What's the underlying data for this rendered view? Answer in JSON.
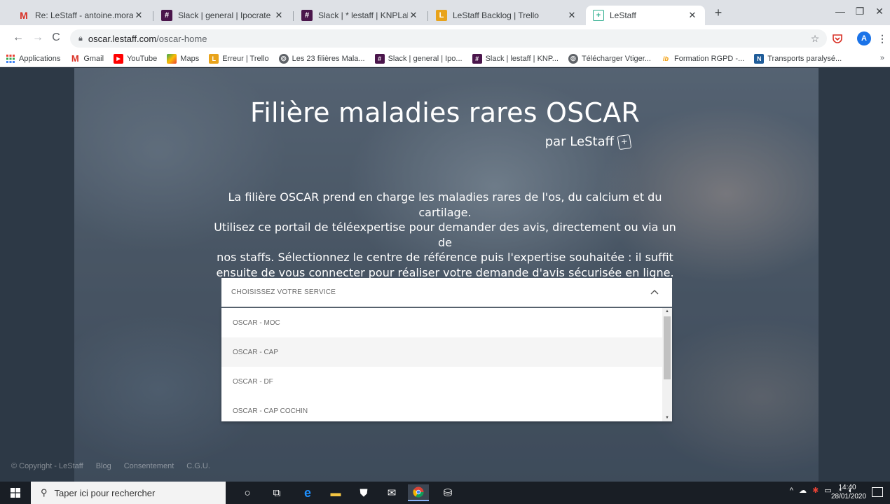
{
  "browser": {
    "tabs": [
      {
        "title": "Re: LeStaff - antoine.morant@ipo",
        "icon": "gmail-icon",
        "color": "#d93025",
        "glyph": "M"
      },
      {
        "title": "Slack | general | Ipocrate",
        "icon": "slack-icon",
        "color": "#4a154b",
        "glyph": "#"
      },
      {
        "title": "Slack | * lestaff | KNPLabs",
        "icon": "slack-icon",
        "color": "#4a154b",
        "glyph": "#"
      },
      {
        "title": "LeStaff Backlog | Trello",
        "icon": "trello-icon",
        "color": "#e8a31b",
        "glyph": "L"
      },
      {
        "title": "LeStaff",
        "icon": "lestaff-icon",
        "color": "#2fae8f",
        "glyph": "+"
      }
    ],
    "active_tab": 4,
    "new_tab": "+",
    "url_host": "oscar.lestaff.com",
    "url_path": "/oscar-home",
    "profile_initial": "A",
    "bookmarks": [
      {
        "label": "Applications",
        "icon": "apps-grid-icon",
        "color": "#e94235",
        "glyph": "⋮"
      },
      {
        "label": "Gmail",
        "icon": "gmail-icon",
        "color": "#d93025",
        "glyph": "M"
      },
      {
        "label": "YouTube",
        "icon": "youtube-icon",
        "color": "#ff0000",
        "glyph": "▶"
      },
      {
        "label": "Maps",
        "icon": "maps-icon",
        "color": "#34a853",
        "glyph": "◆"
      },
      {
        "label": "Erreur | Trello",
        "icon": "trello-icon",
        "color": "#e8a31b",
        "glyph": "L"
      },
      {
        "label": "Les 23 filières Mala...",
        "icon": "globe-icon",
        "color": "#5f6368",
        "glyph": "◎"
      },
      {
        "label": "Slack | general | Ipo...",
        "icon": "slack-icon",
        "color": "#4a154b",
        "glyph": "#"
      },
      {
        "label": "Slack | lestaff | KNP...",
        "icon": "slack-icon",
        "color": "#4a154b",
        "glyph": "#"
      },
      {
        "label": "Télécharger Vtiger...",
        "icon": "globe-icon",
        "color": "#5f6368",
        "glyph": "◎"
      },
      {
        "label": "Formation RGPD -...",
        "icon": "ib-icon",
        "color": "#f29900",
        "glyph": "ib"
      },
      {
        "label": "Transports paralysé...",
        "icon": "news-icon",
        "color": "#1f5c99",
        "glyph": "N"
      }
    ],
    "bookmarks_more": "»"
  },
  "page": {
    "title": "Filière maladies rares OSCAR",
    "subtitle": "par LeStaff",
    "intro_lines": [
      "La filière OSCAR prend en charge les maladies rares de l'os, du calcium et du cartilage.",
      "Utilisez ce portail de téléexpertise pour demander des avis, directement ou via un de",
      "nos staffs. Sélectionnez le centre de référence puis l'expertise souhaitée : il suffit",
      "ensuite de vous connecter pour réaliser votre demande d'avis sécurisée en ligne."
    ],
    "select": {
      "placeholder": "CHOISISSEZ VOTRE SERVICE",
      "options": [
        "OSCAR - MOC",
        "OSCAR - CAP",
        "OSCAR - DF",
        "OSCAR - CAP COCHIN"
      ],
      "hovered_index": 1
    },
    "footer": {
      "copyright": "© Copyright - LeStaff",
      "blog": "Blog",
      "consent": "Consentement",
      "cgu": "C.G.U."
    }
  },
  "taskbar": {
    "search_placeholder": "Taper ici pour rechercher",
    "time": "14:40",
    "date": "28/01/2020"
  }
}
